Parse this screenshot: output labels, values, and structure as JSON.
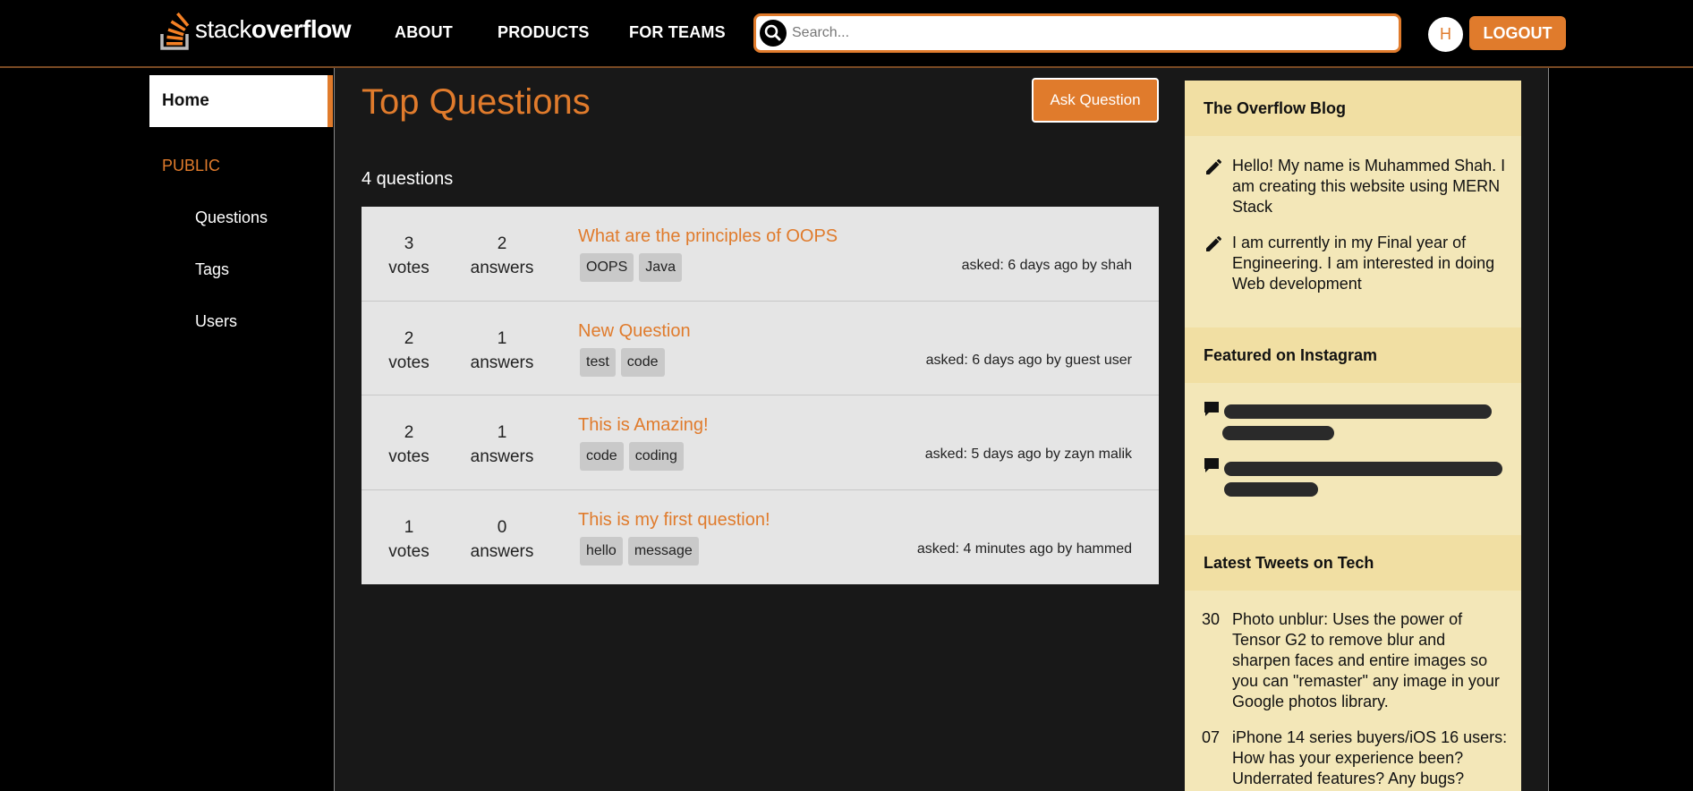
{
  "nav": {
    "logo_part1": "stack",
    "logo_part2": "overflow",
    "links": [
      "ABOUT",
      "PRODUCTS",
      "FOR TEAMS"
    ],
    "search_placeholder": "Search...",
    "avatar_initial": "H",
    "logout_label": "LOGOUT",
    "accent_color": "#e07b2c"
  },
  "sidebar": {
    "home_label": "Home",
    "section_label": "PUBLIC",
    "items": [
      "Questions",
      "Tags",
      "Users"
    ]
  },
  "main": {
    "title": "Top Questions",
    "ask_label": "Ask Question",
    "question_count": "4 questions",
    "questions": [
      {
        "votes": "3",
        "votes_label": "votes",
        "answers": "2",
        "answers_label": "answers",
        "title": "What are the principles of OOPS",
        "tags": [
          "OOPS",
          "Java"
        ],
        "asked": "asked: 6 days ago by shah"
      },
      {
        "votes": "2",
        "votes_label": "votes",
        "answers": "1",
        "answers_label": "answers",
        "title": "New Question",
        "tags": [
          "test",
          "code"
        ],
        "asked": "asked: 6 days ago by guest user"
      },
      {
        "votes": "2",
        "votes_label": "votes",
        "answers": "1",
        "answers_label": "answers",
        "title": "This is Amazing!",
        "tags": [
          "code",
          "coding"
        ],
        "asked": "asked: 5 days ago by zayn malik"
      },
      {
        "votes": "1",
        "votes_label": "votes",
        "answers": "0",
        "answers_label": "answers",
        "title": "This is my first question!",
        "tags": [
          "hello",
          "message"
        ],
        "asked": "asked: 4 minutes ago by hammed"
      }
    ]
  },
  "widget": {
    "blog_heading": "The Overflow Blog",
    "blog_items": [
      "Hello! My name is Muhammed Shah. I am creating this website using MERN Stack",
      "I am currently in my Final year of Engineering. I am interested in doing Web development"
    ],
    "instagram_heading": "Featured on Instagram",
    "tweets_heading": "Latest Tweets on Tech",
    "tweets": [
      {
        "num": "30",
        "text": "Photo unblur: Uses the power of Tensor G2 to remove blur and sharpen faces and entire images so you can \"remaster\" any image in your Google photos library."
      },
      {
        "num": "07",
        "text": "iPhone 14 series buyers/iOS 16 users: How has your experience been? Underrated features? Any bugs?"
      }
    ]
  }
}
